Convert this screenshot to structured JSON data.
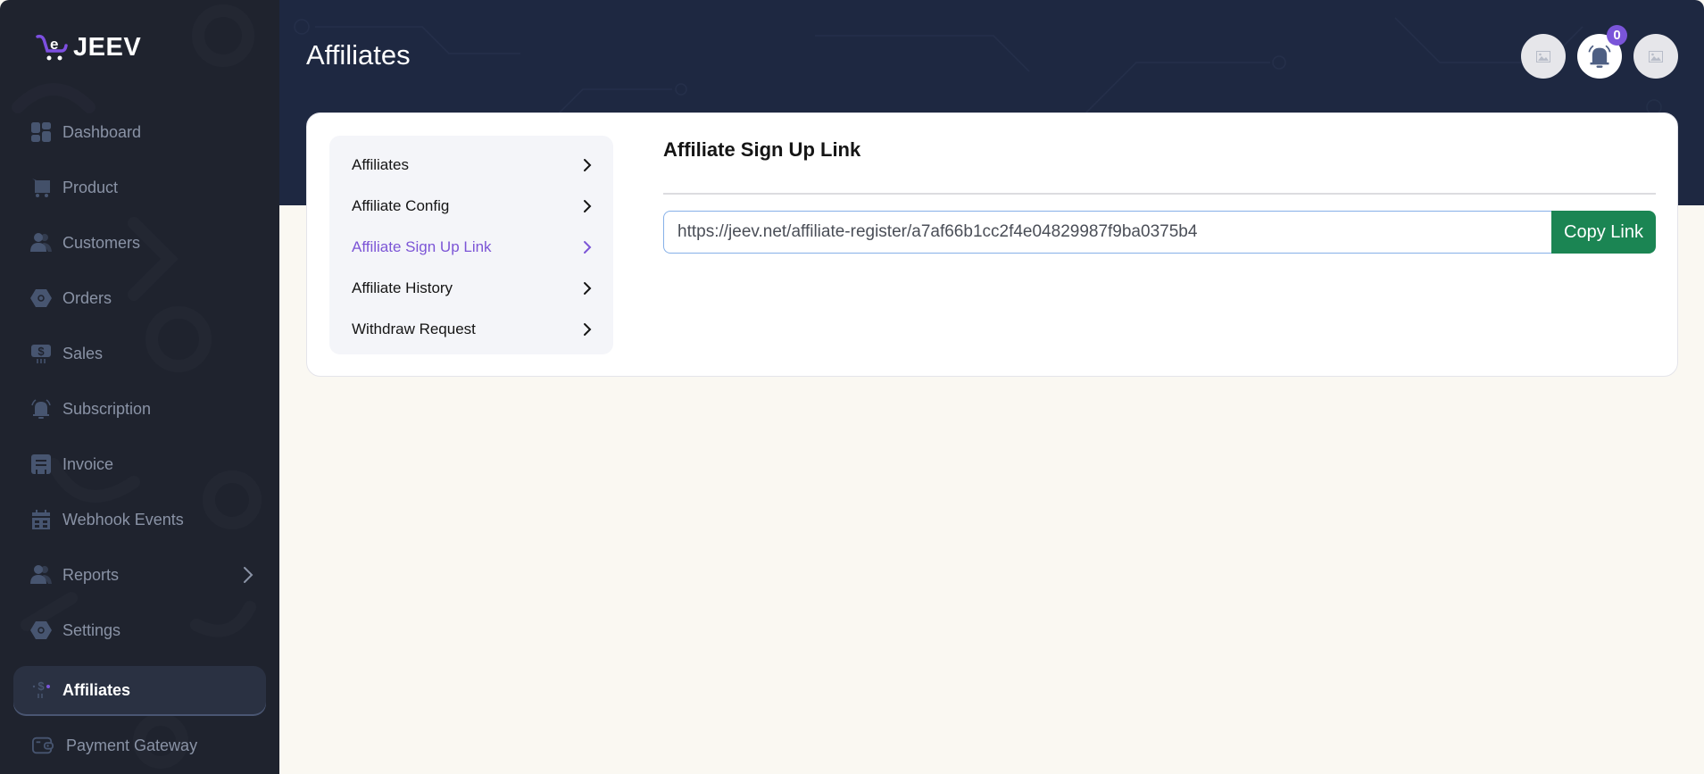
{
  "app": {
    "logo_text": "JEEV",
    "logo_mark": "e"
  },
  "sidebar": {
    "items": [
      {
        "label": "Dashboard",
        "icon": "dashboard-grid-icon"
      },
      {
        "label": "Product",
        "icon": "cart-icon"
      },
      {
        "label": "Customers",
        "icon": "users-icon"
      },
      {
        "label": "Orders",
        "icon": "hexagon-icon"
      },
      {
        "label": "Sales",
        "icon": "dollar-sign-icon"
      },
      {
        "label": "Subscription",
        "icon": "bell-ring-icon"
      },
      {
        "label": "Invoice",
        "icon": "invoice-icon"
      },
      {
        "label": "Webhook Events",
        "icon": "calendar-icon"
      },
      {
        "label": "Reports",
        "icon": "users-icon",
        "has_submenu": true
      },
      {
        "label": "Settings",
        "icon": "hexagon-icon"
      },
      {
        "label": "Affiliates",
        "icon": "dollar-sign-icon",
        "active": true
      },
      {
        "label": "Payment Gateway",
        "icon": "wallet-icon"
      }
    ]
  },
  "header": {
    "title": "Affiliates",
    "notification_count": "0",
    "colors": {
      "badge": "#7a55d9",
      "band": "#1e2841"
    }
  },
  "submenu": {
    "items": [
      {
        "label": "Affiliates"
      },
      {
        "label": "Affiliate Config"
      },
      {
        "label": "Affiliate Sign Up Link",
        "active": true
      },
      {
        "label": "Affiliate History"
      },
      {
        "label": "Withdraw Request"
      }
    ],
    "active_color": "#7c55d6"
  },
  "main": {
    "section_title": "Affiliate Sign Up Link",
    "link_value": "https://jeev.net/affiliate-register/a7af66b1cc2f4e04829987f9ba0375b4",
    "copy_button_label": "Copy Link",
    "copy_button_color": "#1b8553"
  }
}
